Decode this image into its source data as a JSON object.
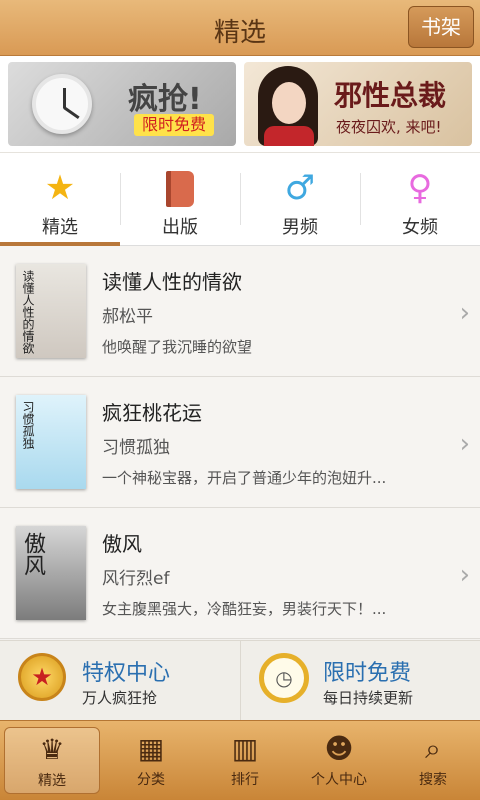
{
  "header": {
    "title": "精选",
    "shelf_button": "书架"
  },
  "banners": {
    "left": {
      "title": "疯抢!",
      "tag": "限时免费"
    },
    "right": {
      "title": "邪性总裁",
      "subtitle": "夜夜囚欢, 来吧!"
    }
  },
  "tabs": [
    {
      "label": "精选",
      "icon": "star-icon"
    },
    {
      "label": "出版",
      "icon": "book-icon"
    },
    {
      "label": "男频",
      "icon": "male-icon"
    },
    {
      "label": "女频",
      "icon": "female-icon"
    }
  ],
  "books": [
    {
      "title": "读懂人性的情欲",
      "author": "郝松平",
      "desc": "他唤醒了我沉睡的欲望",
      "cover_text": "读懂人性的情欲"
    },
    {
      "title": "疯狂桃花运",
      "author": "习惯孤独",
      "desc": "一个神秘宝器，开启了普通少年的泡妞升...",
      "cover_text": "习惯孤独"
    },
    {
      "title": "傲风",
      "author": "风行烈ef",
      "desc": "女主腹黑强大，冷酷狂妄，男装行天下！...",
      "cover_text": "傲风"
    }
  ],
  "promo": {
    "left": {
      "title": "特权中心",
      "subtitle": "万人疯狂抢"
    },
    "right": {
      "title": "限时免费",
      "subtitle": "每日持续更新"
    }
  },
  "bottom_nav": [
    {
      "label": "精选",
      "icon": "crown-icon"
    },
    {
      "label": "分类",
      "icon": "grid-icon"
    },
    {
      "label": "排行",
      "icon": "bar-chart-icon"
    },
    {
      "label": "个人中心",
      "icon": "user-icon"
    },
    {
      "label": "搜索",
      "icon": "search-icon"
    }
  ],
  "colors": {
    "header": "#d99a55",
    "accent": "#b8773a",
    "link": "#2a6fb0"
  }
}
